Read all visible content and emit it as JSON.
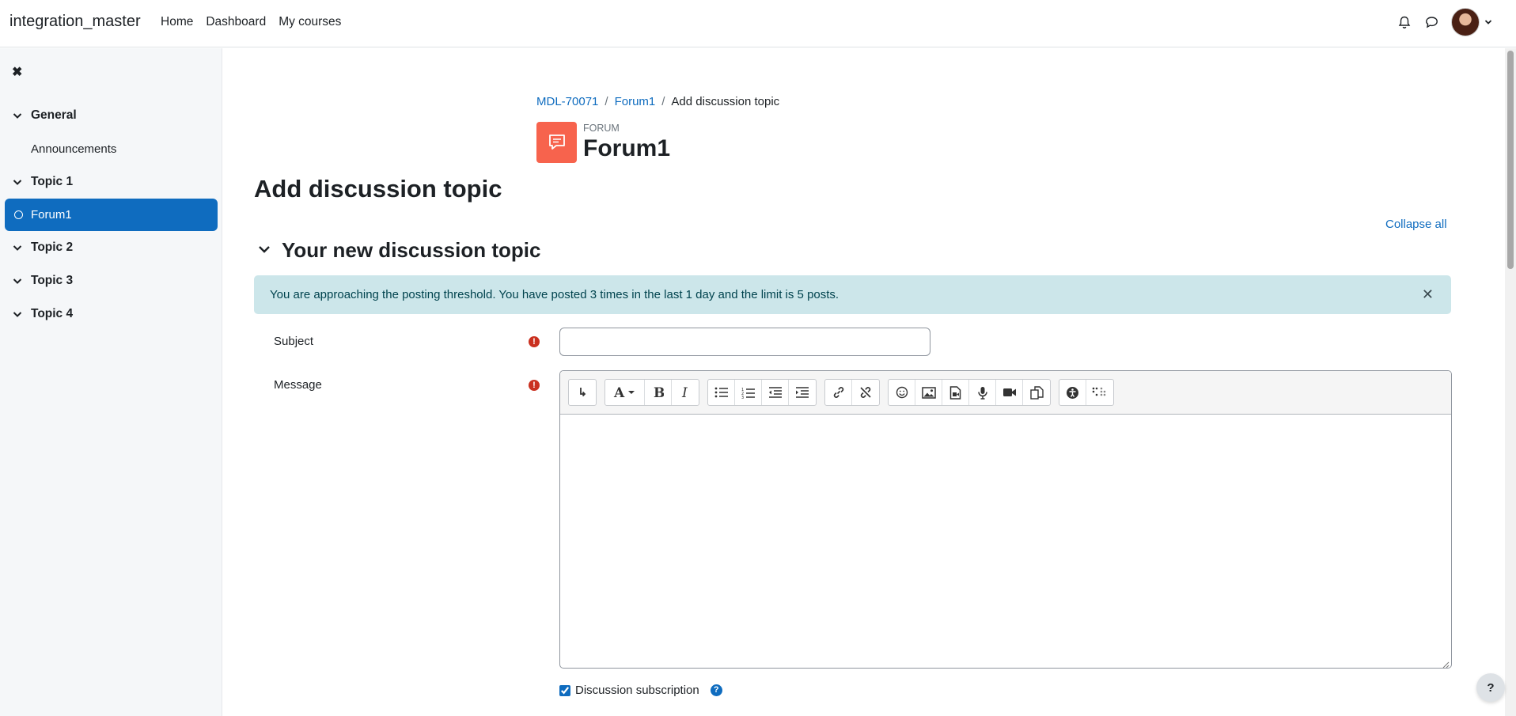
{
  "site": {
    "name": "integration_master"
  },
  "primary_nav": [
    {
      "label": "Home"
    },
    {
      "label": "Dashboard"
    },
    {
      "label": "My courses"
    }
  ],
  "drawer": {
    "close_icon": "close-icon",
    "course_index": {
      "sections": [
        {
          "label": "General",
          "items": [
            "Announcements"
          ]
        },
        {
          "label": "Topic 1",
          "items": [
            "Forum1"
          ]
        },
        {
          "label": "Topic 2"
        },
        {
          "label": "Topic 3"
        },
        {
          "label": "Topic 4"
        }
      ],
      "active_item": "Forum1"
    }
  },
  "breadcrumb": [
    {
      "label": "MDL-70071"
    },
    {
      "label": "Forum1"
    },
    {
      "label": "Add discussion topic"
    }
  ],
  "activity": {
    "type": "FORUM",
    "name": "Forum1",
    "color": "#f7634d"
  },
  "page_heading": "Add discussion topic",
  "collapse_all": "Collapse all",
  "legend": "Your new discussion topic",
  "alert": {
    "text": "You are approaching the posting threshold. You have posted 3 times in the last 1 day and the limit is 5 posts."
  },
  "form": {
    "subject_label": "Subject",
    "message_label": "Message",
    "subject_value": "",
    "subscription_label": "Discussion subscription",
    "subscription_checked": true
  },
  "colors": {
    "primary": "#0f6cbf",
    "required": "#ca3120",
    "alert_bg": "#cce6ea",
    "drawer_bg": "#f5f7f9"
  }
}
